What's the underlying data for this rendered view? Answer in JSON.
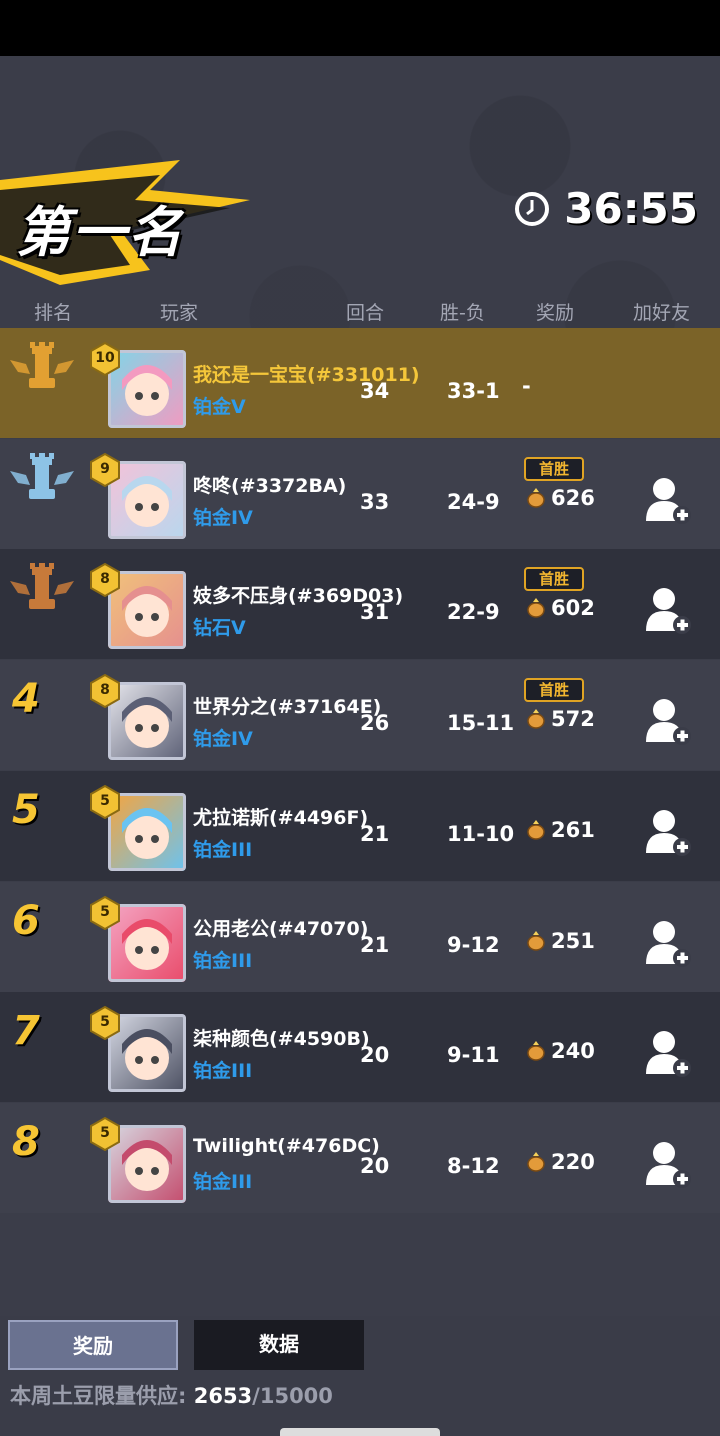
{
  "banner": {
    "title": "第一名"
  },
  "timer": {
    "value": "36:55",
    "icon": "clock-icon"
  },
  "headers": {
    "rank": "排名",
    "player": "玩家",
    "rounds": "回合",
    "winloss": "胜-负",
    "reward": "奖励",
    "add_friend": "加好友"
  },
  "colors": {
    "gold_row": "#7b6328",
    "tier_blue": "#2f9bea",
    "rank_yellow": "#f6c534"
  },
  "rows": [
    {
      "rank": "1",
      "trophy": "gold-rook-trophy-icon",
      "level": "10",
      "name": "我还是一宝宝(#331011)",
      "tier": "铂金V",
      "rounds": "34",
      "winloss": "33-1",
      "badge": "",
      "reward": "-",
      "has_add": false
    },
    {
      "rank": "2",
      "trophy": "silver-rook-trophy-icon",
      "level": "9",
      "name": "咚咚(#3372BA)",
      "tier": "铂金IV",
      "rounds": "33",
      "winloss": "24-9",
      "badge": "首胜",
      "reward": "626",
      "has_add": true
    },
    {
      "rank": "3",
      "trophy": "bronze-rook-trophy-icon",
      "level": "8",
      "name": "妓多不压身(#369D03)",
      "tier": "钻石V",
      "rounds": "31",
      "winloss": "22-9",
      "badge": "首胜",
      "reward": "602",
      "has_add": true
    },
    {
      "rank": "4",
      "trophy": "",
      "level": "8",
      "name": "世界分之(#37164E)",
      "tier": "铂金IV",
      "rounds": "26",
      "winloss": "15-11",
      "badge": "首胜",
      "reward": "572",
      "has_add": true
    },
    {
      "rank": "5",
      "trophy": "",
      "level": "5",
      "name": "尤拉诺斯(#4496F)",
      "tier": "铂金III",
      "rounds": "21",
      "winloss": "11-10",
      "badge": "",
      "reward": "261",
      "has_add": true
    },
    {
      "rank": "6",
      "trophy": "",
      "level": "5",
      "name": "公用老公(#47070)",
      "tier": "铂金III",
      "rounds": "21",
      "winloss": "9-12",
      "badge": "",
      "reward": "251",
      "has_add": true
    },
    {
      "rank": "7",
      "trophy": "",
      "level": "5",
      "name": "柒种颜色(#4590B)",
      "tier": "铂金III",
      "rounds": "20",
      "winloss": "9-11",
      "badge": "",
      "reward": "240",
      "has_add": true
    },
    {
      "rank": "8",
      "trophy": "",
      "level": "5",
      "name": "Twilight(#476DC)",
      "tier": "铂金III",
      "rounds": "20",
      "winloss": "8-12",
      "badge": "",
      "reward": "220",
      "has_add": true
    }
  ],
  "tabs": {
    "reward": "奖励",
    "data": "数据"
  },
  "supply": {
    "label": "本周土豆限量供应: ",
    "current": "2653",
    "total": "/15000"
  }
}
